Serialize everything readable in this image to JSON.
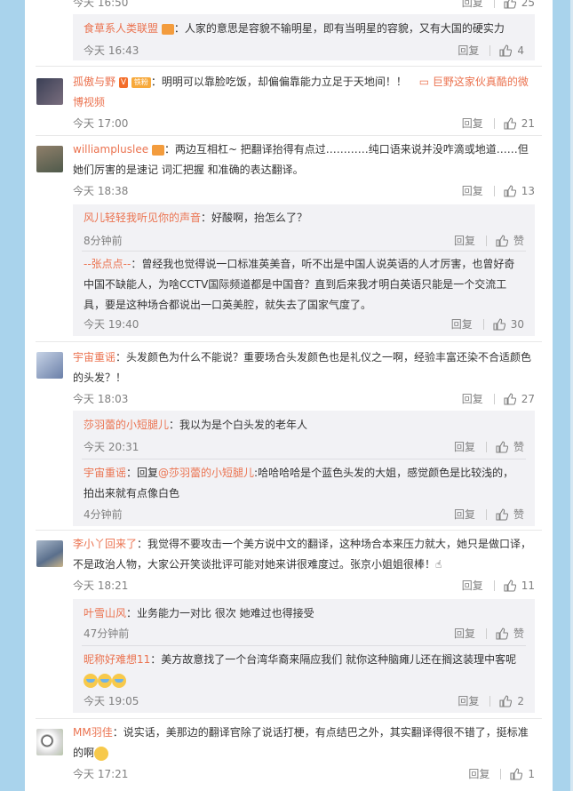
{
  "colors": {
    "page_bg": "#a9d3ec",
    "card_bg": "#ffffff",
    "sub_bg": "#f2f2f5",
    "username": "#eb7350",
    "meta": "#808080"
  },
  "top": {
    "ts": "今天 16:50",
    "reply": "回复",
    "likes": "25",
    "sub": {
      "user": "食草系人类联盟",
      "text": "：人家的意思是容貌不输明星，即有当明星的容貌，又有大国的硬实力",
      "ts": "今天 16:43",
      "reply": "回复",
      "likes": "4"
    }
  },
  "c1": {
    "user": "孤傲与野",
    "badge_v": "V",
    "badge_fan": "铁粉",
    "text": "：明明可以靠脸吃饭，却偏偏靠能力立足于天地间！！",
    "link": "巨野这家伙真酷的微博视频",
    "ts": "今天 17:00",
    "reply": "回复",
    "likes": "21"
  },
  "c2": {
    "user": "williampluslee",
    "text": "：两边互相杠~  把翻译抬得有点过…………纯口语来说并没咋滴或地道……但她们厉害的是速记 词汇把握 和准确的表达翻译。",
    "ts": "今天 18:38",
    "reply": "回复",
    "likes": "13",
    "subs": [
      {
        "user": "风儿轻轻我听见你的声音",
        "text": "：好酸啊，抬怎么了？",
        "ts": "8分钟前",
        "reply": "回复",
        "likes": "赞"
      },
      {
        "user": "--张点点--",
        "text": "：曾经我也觉得说一口标准英美音，听不出是中国人说英语的人才厉害，也曾好奇中国不缺能人，为啥CCTV国际频道都是中国音？直到后来我才明白英语只能是一个交流工具，要是这种场合都说出一口英美腔，就失去了国家气度了。",
        "ts": "今天 19:40",
        "reply": "回复",
        "likes": "30"
      }
    ]
  },
  "c3": {
    "user": "宇宙重谣",
    "text": "：头发颜色为什么不能说？重要场合头发颜色也是礼仪之一啊，经验丰富还染不合适颜色的头发？！",
    "ts": "今天 18:03",
    "reply": "回复",
    "likes": "27",
    "subs": [
      {
        "user": "莎羽蕾的小短腿儿",
        "text": "：我以为是个白头发的老年人",
        "ts": "今天 20:31",
        "reply": "回复",
        "likes": "赞"
      },
      {
        "user": "宇宙重谣",
        "pre": "：回复",
        "mention": "@莎羽蕾的小短腿儿",
        "text": ":哈哈哈哈是个蓝色头发的大姐，感觉颜色是比较浅的，拍出来就有点像白色",
        "ts": "4分钟前",
        "reply": "回复",
        "likes": "赞"
      }
    ]
  },
  "c4": {
    "user": "李小丫回来了",
    "text": "：我觉得不要攻击一个美方说中文的翻译，这种场合本来压力就大，她只是做口译，不是政治人物，大家公开笑谈批评可能对她来讲很难度过。张京小姐姐很棒！",
    "ts": "今天 18:21",
    "reply": "回复",
    "likes": "11",
    "subs": [
      {
        "user": "叶雪山风",
        "text": "：业务能力一对比 很次 她难过也得接受",
        "ts": "47分钟前",
        "reply": "回复",
        "likes": "赞"
      },
      {
        "user": "昵称好难想11",
        "text": "：美方故意找了一个台湾华裔来隔应我们 就你这种脑瘫儿还在搁这装理中客呢",
        "ts": "今天 19:05",
        "reply": "回复",
        "likes": "2"
      }
    ]
  },
  "c5": {
    "user": "MM羽佳",
    "text": "：说实话，美那边的翻译官除了说话打梗，有点结巴之外，其实翻译得很不错了，挺标准的啊",
    "ts": "今天 17:21",
    "reply": "回复",
    "likes": "1"
  }
}
